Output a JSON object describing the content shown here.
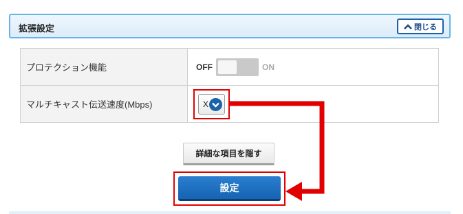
{
  "panel": {
    "title": "拡張設定",
    "close_label": "閉じる",
    "close_icon": "chevron-up-icon"
  },
  "settings": {
    "rows": [
      {
        "label": "プロテクション機能",
        "off_label": "OFF",
        "on_label": "ON",
        "state": "OFF"
      },
      {
        "label": "マルチキャスト伝送速度(Mbps)",
        "selected_value": "X",
        "dropdown_icon": "chevron-down-icon"
      }
    ]
  },
  "buttons": {
    "hide_details_label": "詳細な項目を隠す",
    "submit_label": "設定"
  },
  "annotation": {
    "highlight_color": "#e00000",
    "arrow_color": "#e00000"
  },
  "colors": {
    "accent_blue": "#1a63a8",
    "header_border": "#6ab4e4"
  }
}
